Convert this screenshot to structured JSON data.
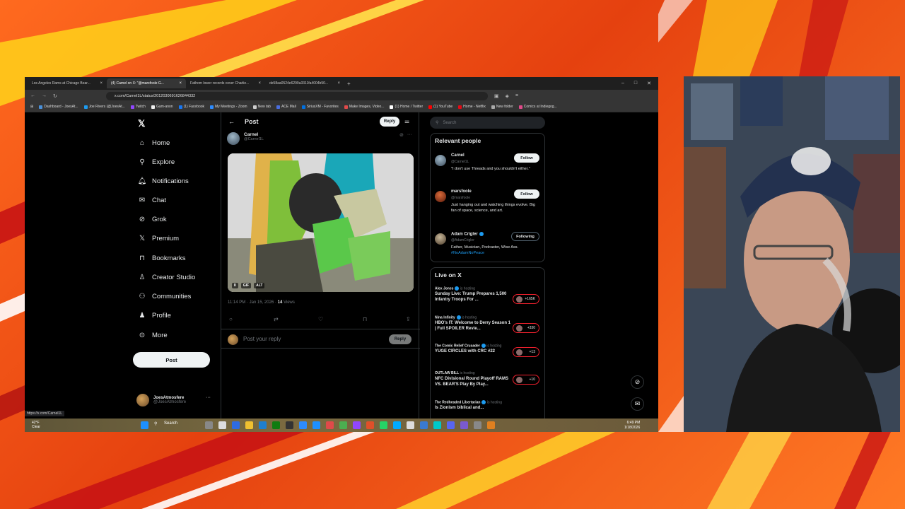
{
  "browser": {
    "tabs": [
      "Los Angeles Rams at Chicago Bear...",
      "(4) Carnel on X: \"@marsfoole G...",
      "Fathom lower records cover Charlie...",
      "de58aa0524e6299a3311fa4004b50..."
    ],
    "url": "x.com/Carnel1L/status/2012030691626844332",
    "bookmarks": [
      "Dashboard - JoesAt...",
      "Joe Rivers (@JoesAt...",
      "Twitch",
      "Gam-anon",
      "(1) Facebook",
      "My Meetings - Zoom",
      "New tab",
      "ACE Mail",
      "SiriusXM - Favorites",
      "Make Images, Video...",
      "(1) Home / Twitter",
      "(1) YouTube",
      "Home - Netflix",
      "New folder",
      "Comics at Indiegog..."
    ]
  },
  "nav": {
    "items": [
      "Home",
      "Explore",
      "Notifications",
      "Chat",
      "Grok",
      "Premium",
      "Bookmarks",
      "Creator Studio",
      "Communities",
      "Profile",
      "More"
    ],
    "post_label": "Post",
    "account_name": "JoesAtmosfere",
    "account_handle": "@JoesAtmosfere"
  },
  "post": {
    "header_title": "Post",
    "reply_top_label": "Reply",
    "author_name": "Carnel",
    "author_handle": "@Carnel1L",
    "media_badges": [
      "GIF",
      "ALT"
    ],
    "time": "11:14 PM · Jan 15, 2026 · ",
    "views_count": "14",
    "views_label": " Views",
    "reply_placeholder": "Post your reply",
    "reply_button": "Reply"
  },
  "sidebar": {
    "search_placeholder": "Search",
    "relevant_title": "Relevant people",
    "people": [
      {
        "name": "Carnel",
        "handle": "@Carnel1L",
        "bio": "\"I don't use Threads and you shouldn't either.\"",
        "button": "Follow"
      },
      {
        "name": "marsfoole",
        "handle": "@marsfoole",
        "bio": "Just hanging out and watching things evolve. Big fan of space, science, and art.",
        "button": "Follow"
      },
      {
        "name": "Adam Crigler",
        "handle": "@AdamCrigler",
        "bio": "Father, Musician, Podcaster, Wise Ass.",
        "tag": "#NoAdamNoPeace",
        "button": "Following"
      }
    ],
    "live_title": "Live on X",
    "live": [
      {
        "host": "Alex Jones",
        "status": "is hosting",
        "title": "Sunday Live: Trump Prepares 1,500 Infantry Troops For ...",
        "count": "+165K"
      },
      {
        "host": "Nina Infinity",
        "status": "is hosting",
        "title": "HBO's IT: Welcome to Derry Season 1 | Full SPOILER Revie...",
        "count": "+330"
      },
      {
        "host": "The Comic Relief Crusader",
        "status": "is hosting",
        "title": "YUGE CIRCLES with CRC #22",
        "count": "+13"
      },
      {
        "host": "OUTLAW BILL",
        "status": "is hosting",
        "title": "NFC Divisional Round Playoff RAMS VS. BEAR'S Play By Play...",
        "count": "+10"
      },
      {
        "host": "The Redheaded Libertarian",
        "status": "is hosting",
        "title": "Is Zionism biblical and...",
        "count": ""
      }
    ]
  },
  "status_url": "https://x.com/Carnel1L",
  "taskbar": {
    "weather_temp": "42°F",
    "weather_desc": "Clear",
    "search_label": "Search",
    "time": "6:49 PM",
    "date": "1/18/2026"
  },
  "colors": {
    "accent": "#1d9bf0",
    "live_red": "#f4212e",
    "background": "#000000"
  }
}
